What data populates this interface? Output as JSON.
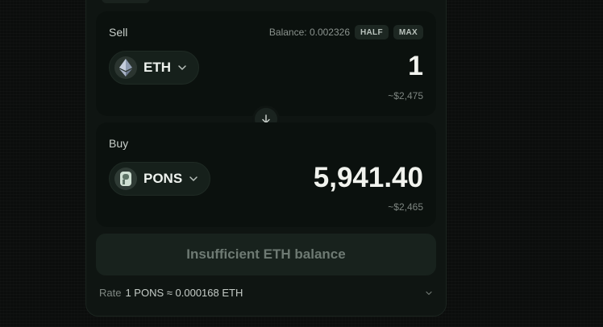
{
  "sell": {
    "label": "Sell",
    "balance_text": "Balance: 0.002326",
    "half_label": "HALF",
    "max_label": "MAX",
    "token": {
      "symbol": "ETH",
      "icon": "ethereum-icon"
    },
    "amount": "1",
    "fiat": "~$2,475"
  },
  "buy": {
    "label": "Buy",
    "token": {
      "symbol": "PONS",
      "icon": "pons-token-icon"
    },
    "amount": "5,941.40",
    "fiat": "~$2,465"
  },
  "swap_direction_icon": "arrow-down-icon",
  "action_button_label": "Insufficient ETH balance",
  "rate": {
    "label": "Rate",
    "value": "1 PONS ≈ 0.000168 ETH"
  },
  "colors": {
    "background": "#0b0d0c",
    "card": "#0f1512",
    "panel": "#0b110e",
    "disabled_text": "#6e7a73"
  }
}
